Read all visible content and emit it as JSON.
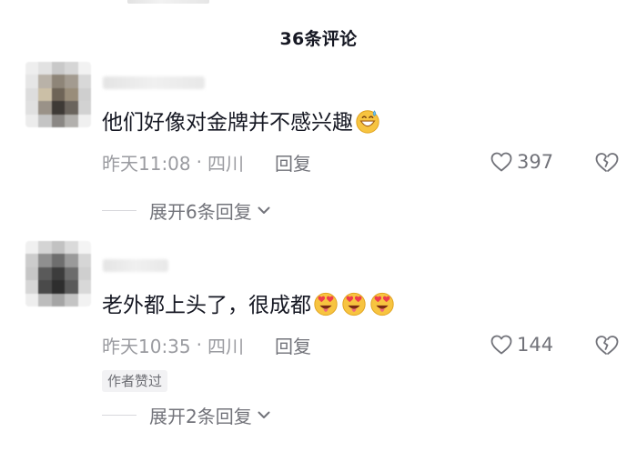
{
  "header": {
    "title": "36条评论"
  },
  "comments": [
    {
      "text": "他们好像对金牌并不感兴趣",
      "emojis": [
        "grinning-sweat-emoji"
      ],
      "time": "昨天11:08",
      "separator": "·",
      "location": "四川",
      "reply_label": "回复",
      "likes": "397",
      "author_liked": "",
      "expand_label": "展开6条回复"
    },
    {
      "text": "老外都上头了，很成都",
      "emojis": [
        "heart-eyes-tongue-emoji",
        "heart-eyes-tongue-emoji",
        "heart-eyes-tongue-emoji"
      ],
      "time": "昨天10:35",
      "separator": "·",
      "location": "四川",
      "reply_label": "回复",
      "likes": "144",
      "author_liked": "作者赞过",
      "expand_label": "展开2条回复"
    }
  ],
  "colors": {
    "primary_text": "#161823",
    "secondary_text": "#9a9ba0",
    "action_text": "#72737a",
    "badge_bg": "#f2f2f4"
  },
  "icons": {
    "like": "heart-outline-icon",
    "dislike": "heart-broken-outline-icon",
    "expand": "chevron-down-icon"
  }
}
